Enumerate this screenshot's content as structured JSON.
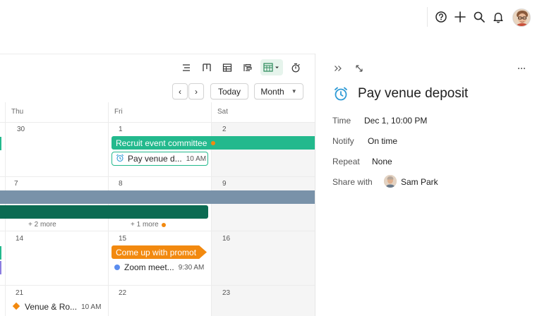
{
  "topbar": {
    "icons": [
      "help-icon",
      "add-icon",
      "search-icon",
      "bell-icon"
    ],
    "user_avatar": "avatar"
  },
  "toolbar": {
    "views": [
      "list-view-icon",
      "board-view-icon",
      "table-view-icon",
      "timeline-view-icon",
      "calendar-view-icon",
      "stopwatch-icon"
    ],
    "active_view": "calendar-view-icon",
    "prev_label": "‹",
    "next_label": "›",
    "today_label": "Today",
    "range_label": "Month"
  },
  "calendar": {
    "weekdays": [
      "Thu",
      "Fri",
      "Sat"
    ],
    "weeks": [
      {
        "days": [
          "30",
          "1",
          "2"
        ]
      },
      {
        "days": [
          "7",
          "8",
          "9"
        ]
      },
      {
        "days": [
          "14",
          "15",
          "16"
        ]
      },
      {
        "days": [
          "21",
          "22",
          "23"
        ]
      }
    ],
    "events": {
      "recruit": "Recruit event committee",
      "pay": "Pay venue d...",
      "pay_time": "10 AM",
      "more_thu": "+ 2 more",
      "more_fri": "+ 1 more",
      "promo": "Come up with promot",
      "zoom": "Zoom meet...",
      "zoom_time": "9:30 AM",
      "venue": "Venue & Ro...",
      "venue_time": "10 AM"
    },
    "colors": {
      "green": "#23b98d",
      "slate": "#7992a9",
      "dark_green": "#0b6b52",
      "orange": "#f2890f",
      "blue": "#5b8def",
      "purple": "#8b7de0"
    }
  },
  "detail": {
    "title": "Pay venue deposit",
    "time_label": "Time",
    "time_value": "Dec 1, 10:00 PM",
    "notify_label": "Notify",
    "notify_value": "On time",
    "repeat_label": "Repeat",
    "repeat_value": "None",
    "share_label": "Share with",
    "share_value": "Sam Park",
    "accent": "#2f9bd6"
  }
}
